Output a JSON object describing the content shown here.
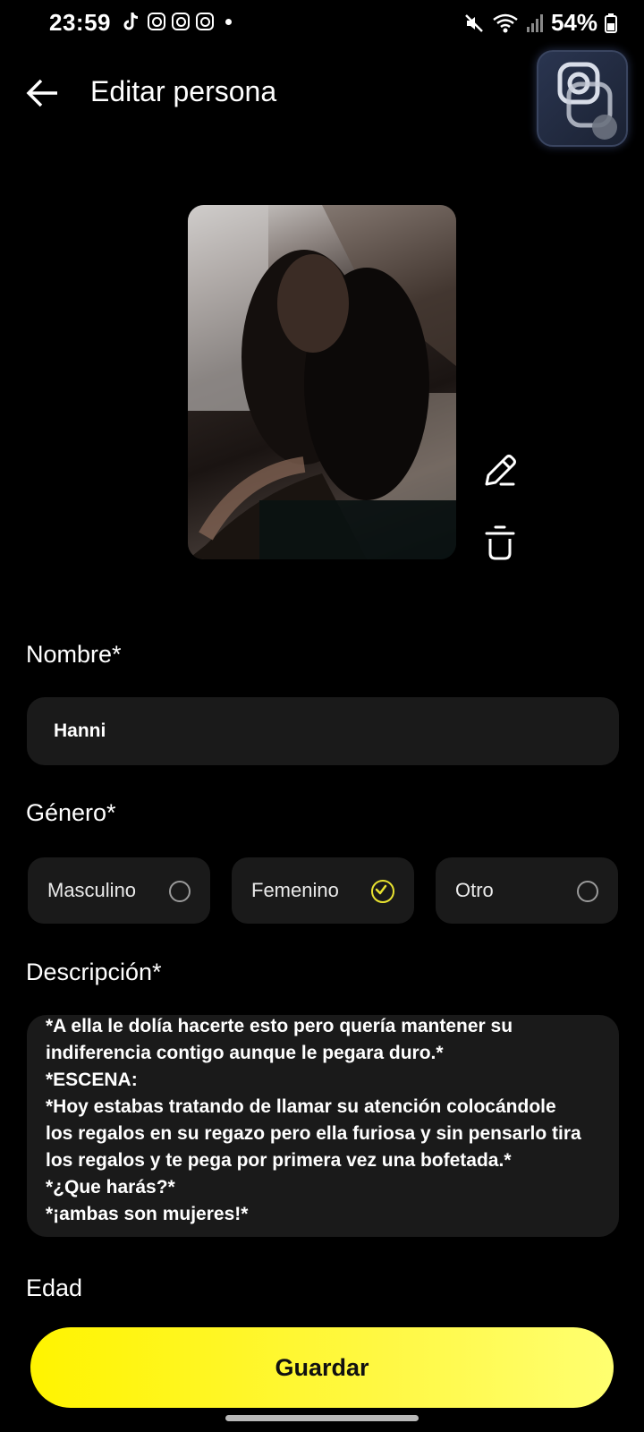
{
  "status_bar": {
    "time": "23:59",
    "battery": "54%",
    "left_icons": [
      "tiktok-icon",
      "instagram-icon",
      "instagram-icon",
      "instagram-icon",
      "notification-dot"
    ],
    "right_icons": [
      "mute-icon",
      "wifi-icon",
      "signal-icon",
      "battery-icon"
    ]
  },
  "header": {
    "title": "Editar persona",
    "back_icon": "arrow-left-icon"
  },
  "avatar": {
    "actions": [
      "edit-icon",
      "trash-icon"
    ]
  },
  "form": {
    "name_label": "Nombre*",
    "name_value": "Hanni",
    "gender_label": "Género*",
    "gender_options": [
      {
        "label": "Masculino",
        "selected": false
      },
      {
        "label": "Femenino",
        "selected": true
      },
      {
        "label": "Otro",
        "selected": false
      }
    ],
    "description_label": "Descripción*",
    "description_lines": [
      "*A ella le dolía hacerte esto pero quería mantener su",
      "indiferencia contigo aunque le pegara duro.*",
      "*ESCENA:",
      "*Hoy estabas tratando de llamar su atención colocándole",
      "los regalos en su regazo pero ella furiosa y sin pensarlo tira",
      "los regalos y te pega por primera vez una bofetada.*",
      "*¿Que harás?*",
      "*¡ambas son mujeres!*"
    ],
    "age_label": "Edad"
  },
  "actions": {
    "save_label": "Guardar"
  },
  "colors": {
    "accent": "#fff400",
    "background": "#000000",
    "field_bg": "#1a1a1a",
    "check": "#e8e230"
  }
}
